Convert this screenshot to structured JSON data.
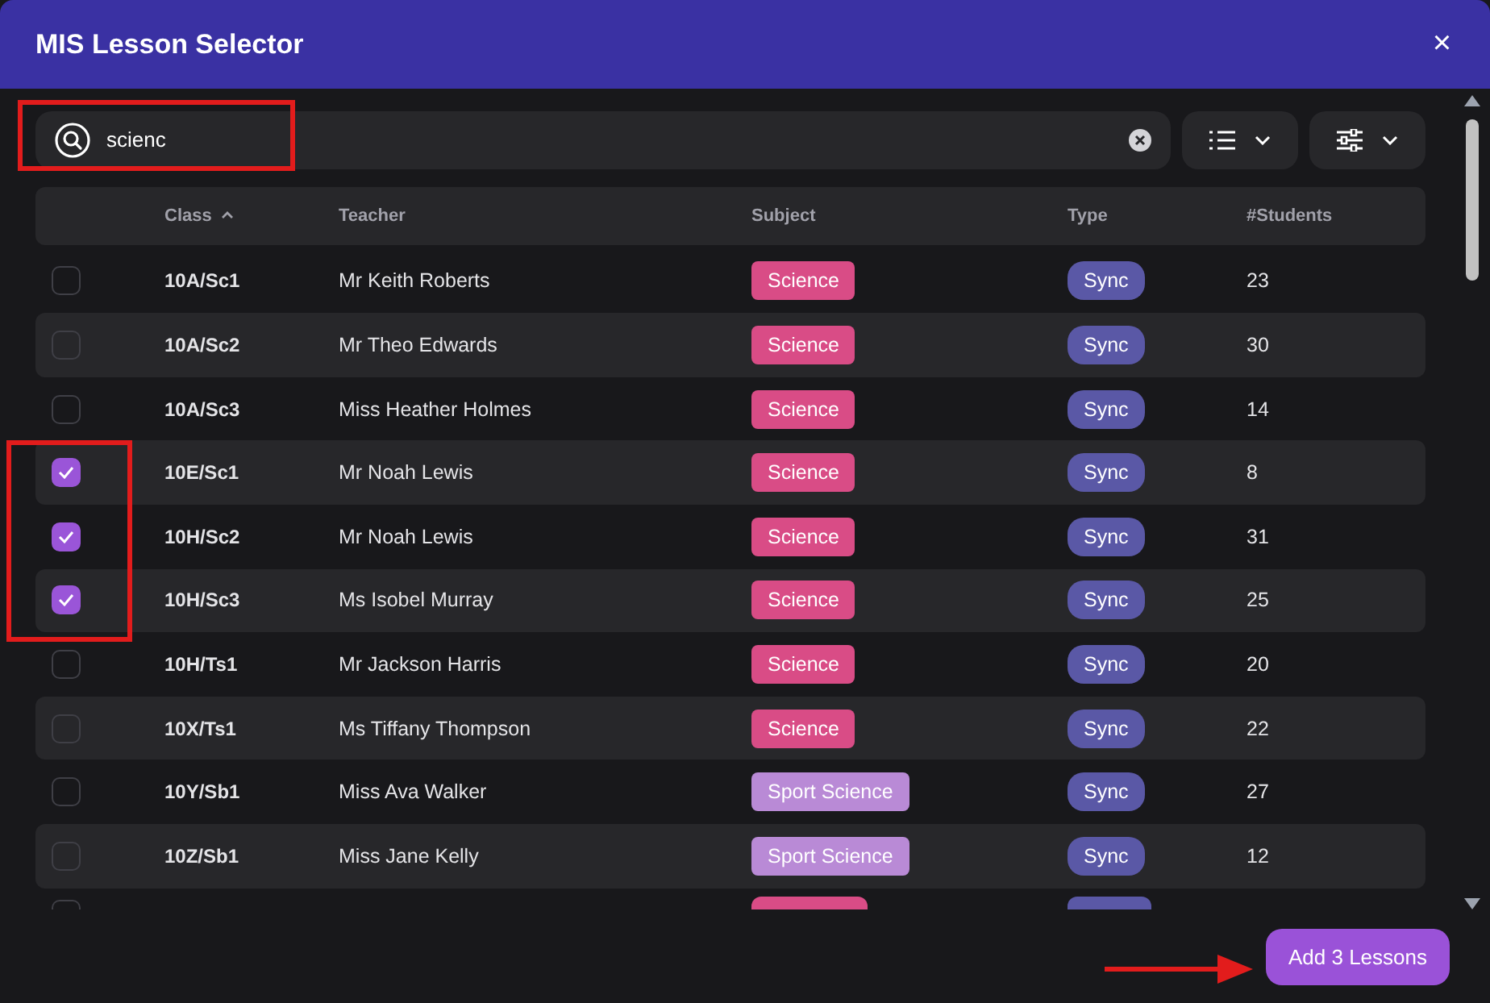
{
  "window": {
    "title": "MIS Lesson Selector",
    "close": "×"
  },
  "search": {
    "value": "scienc"
  },
  "table": {
    "columns": [
      {
        "label": "Class",
        "sorted": true
      },
      {
        "label": "Teacher",
        "sorted": false
      },
      {
        "label": "Subject",
        "sorted": false
      },
      {
        "label": "Type",
        "sorted": false
      },
      {
        "label": "#Students",
        "sorted": false
      }
    ],
    "rows": [
      {
        "checked": false,
        "class": "10A/Sc1",
        "teacher": "Mr Keith Roberts",
        "subject": "Science",
        "color": "#d94c86",
        "type": "Sync",
        "students": "23"
      },
      {
        "checked": false,
        "class": "10A/Sc2",
        "teacher": "Mr Theo Edwards",
        "subject": "Science",
        "color": "#d94c86",
        "type": "Sync",
        "students": "30"
      },
      {
        "checked": false,
        "class": "10A/Sc3",
        "teacher": "Miss Heather Holmes",
        "subject": "Science",
        "color": "#d94c86",
        "type": "Sync",
        "students": "14"
      },
      {
        "checked": true,
        "class": "10E/Sc1",
        "teacher": "Mr Noah Lewis",
        "subject": "Science",
        "color": "#d94c86",
        "type": "Sync",
        "students": "8"
      },
      {
        "checked": true,
        "class": "10H/Sc2",
        "teacher": "Mr Noah Lewis",
        "subject": "Science",
        "color": "#d94c86",
        "type": "Sync",
        "students": "31"
      },
      {
        "checked": true,
        "class": "10H/Sc3",
        "teacher": "Ms Isobel Murray",
        "subject": "Science",
        "color": "#d94c86",
        "type": "Sync",
        "students": "25"
      },
      {
        "checked": false,
        "class": "10H/Ts1",
        "teacher": "Mr Jackson Harris",
        "subject": "Science",
        "color": "#d94c86",
        "type": "Sync",
        "students": "20"
      },
      {
        "checked": false,
        "class": "10X/Ts1",
        "teacher": "Ms Tiffany Thompson",
        "subject": "Science",
        "color": "#d94c86",
        "type": "Sync",
        "students": "22"
      },
      {
        "checked": false,
        "class": "10Y/Sb1",
        "teacher": "Miss Ava Walker",
        "subject": "Sport Science",
        "color": "#b98ad6",
        "type": "Sync",
        "students": "27"
      },
      {
        "checked": false,
        "class": "10Z/Sb1",
        "teacher": "Miss Jane Kelly",
        "subject": "Sport Science",
        "color": "#b98ad6",
        "type": "Sync",
        "students": "12"
      },
      {
        "checked": false,
        "partial": true,
        "color": "#d94c86"
      }
    ]
  },
  "footer": {
    "button": "Add 3 Lessons"
  },
  "annotations": [
    {
      "kind": "search-highlight"
    },
    {
      "kind": "selection-highlight"
    },
    {
      "kind": "button-arrow"
    }
  ]
}
